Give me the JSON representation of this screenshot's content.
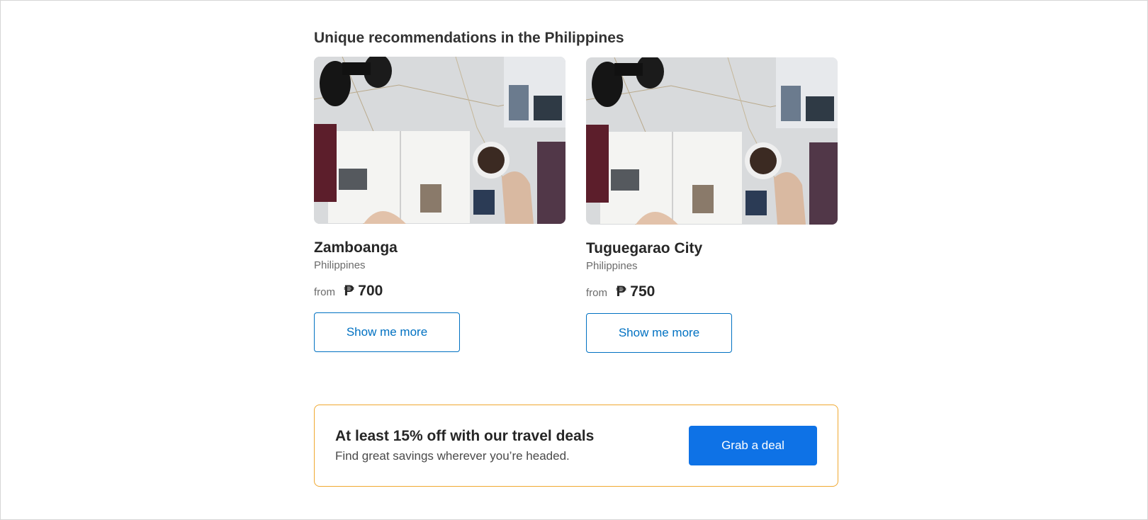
{
  "section": {
    "title": "Unique recommendations in the Philippines"
  },
  "cards": [
    {
      "title": "Zamboanga",
      "country": "Philippines",
      "from_label": "from",
      "price": "₱ 700",
      "button_label": "Show me more"
    },
    {
      "title": "Tuguegarao City",
      "country": "Philippines",
      "from_label": "from",
      "price": "₱ 750",
      "button_label": "Show me more"
    }
  ],
  "deal": {
    "title": "At least 15% off with our travel deals",
    "subtitle": "Find great savings wherever you’re headed.",
    "button_label": "Grab a deal"
  },
  "colors": {
    "accent": "#0071c2",
    "primary_button": "#0e72e6",
    "deal_border": "#f0a830"
  },
  "icons": [
    "travel-photo-image"
  ]
}
